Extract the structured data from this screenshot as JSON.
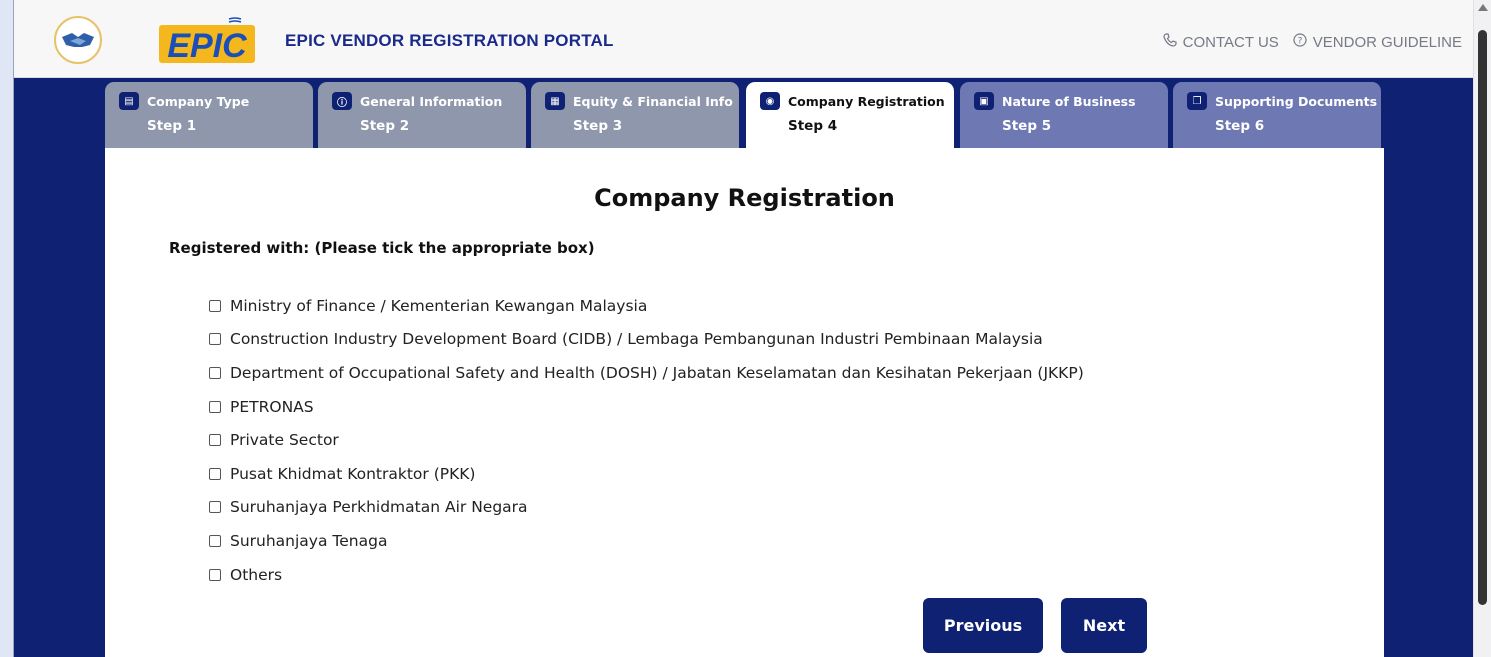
{
  "header": {
    "logo_text": "EPIC",
    "portal_title": "EPIC VENDOR REGISTRATION PORTAL",
    "contact_label": "CONTACT US",
    "guideline_label": "VENDOR GUIDELINE"
  },
  "tabs": [
    {
      "label": "Company Type",
      "step": "Step 1",
      "icon": "building-icon",
      "state": "done"
    },
    {
      "label": "General Information",
      "step": "Step 2",
      "icon": "info-icon",
      "state": "done"
    },
    {
      "label": "Equity & Financial Info",
      "step": "Step 3",
      "icon": "finance-icon",
      "state": "done"
    },
    {
      "label": "Company Registration",
      "step": "Step 4",
      "icon": "registration-icon",
      "state": "active"
    },
    {
      "label": "Nature of Business",
      "step": "Step 5",
      "icon": "briefcase-icon",
      "state": "future"
    },
    {
      "label": "Supporting Documents",
      "step": "Step 6",
      "icon": "documents-icon",
      "state": "future"
    }
  ],
  "panel": {
    "title": "Company Registration",
    "instruction": "Registered with: (Please tick the appropriate box)",
    "options": [
      "Ministry of Finance / Kementerian Kewangan Malaysia",
      "Construction Industry Development Board (CIDB) / Lembaga Pembangunan Industri Pembinaan Malaysia",
      "Department of Occupational Safety and Health (DOSH) / Jabatan Keselamatan dan Kesihatan Pekerjaan (JKKP)",
      "PETRONAS",
      "Private Sector",
      "Pusat Khidmat Kontraktor (PKK)",
      "Suruhanjaya Perkhidmatan Air Negara",
      "Suruhanjaya Tenaga",
      "Others"
    ],
    "previous_label": "Previous",
    "next_label": "Next"
  },
  "colors": {
    "brand_navy": "#0f2173",
    "tab_done": "#8f97ac",
    "tab_future": "#6e78b3"
  }
}
